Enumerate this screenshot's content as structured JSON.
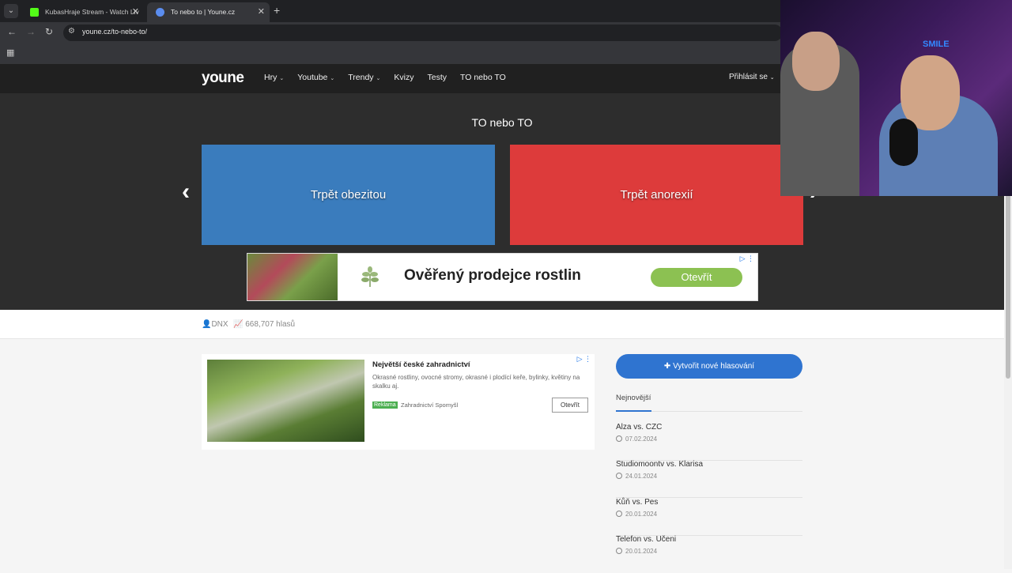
{
  "browser": {
    "tabs": [
      {
        "title": "KubasHraje Stream - Watch Liv",
        "favicon_color": "#53fc18"
      },
      {
        "title": "To nebo to | Youne.cz",
        "favicon_color": "#5b8def"
      }
    ],
    "url": "youne.cz/to-nebo-to/"
  },
  "site": {
    "logo": "youne",
    "nav": [
      {
        "label": "Hry",
        "dropdown": true
      },
      {
        "label": "Youtube",
        "dropdown": true
      },
      {
        "label": "Trendy",
        "dropdown": true
      },
      {
        "label": "Kvizy",
        "dropdown": false
      },
      {
        "label": "Testy",
        "dropdown": false
      },
      {
        "label": "TO nebo TO",
        "dropdown": false
      }
    ],
    "login": "Přihlásit se"
  },
  "hero": {
    "title": "TO nebo TO",
    "option_a": "Trpět obezitou",
    "option_b": "Trpět anorexií"
  },
  "ad_banner": {
    "text": "Ověřený prodejce rostlin",
    "button": "Otevřít"
  },
  "stats": {
    "author": "DNX",
    "votes": "668,707 hlasů"
  },
  "ad_box": {
    "title": "Největší české zahradnictví",
    "description": "Okrasné rostliny, ovocné stromy, okrasné i plodící keře, bylinky, květiny na skalku aj.",
    "badge": "Reklama",
    "advertiser": "Zahradnictví Spomyšl",
    "button": "Otevřít"
  },
  "sidebar": {
    "create_button": "✚ Vytvořit nové hlasování",
    "section_title": "Nejnovější",
    "items": [
      {
        "title": "Alza vs. CZC",
        "date": "07.02.2024"
      },
      {
        "title": "Studiomoontv vs. Klarisa",
        "date": "24.01.2024"
      },
      {
        "title": "Kůň vs. Pes",
        "date": "20.01.2024"
      },
      {
        "title": "Telefon vs. Učeni",
        "date": "20.01.2024"
      }
    ]
  },
  "webcam": {
    "neon_sign": "SMILE"
  }
}
